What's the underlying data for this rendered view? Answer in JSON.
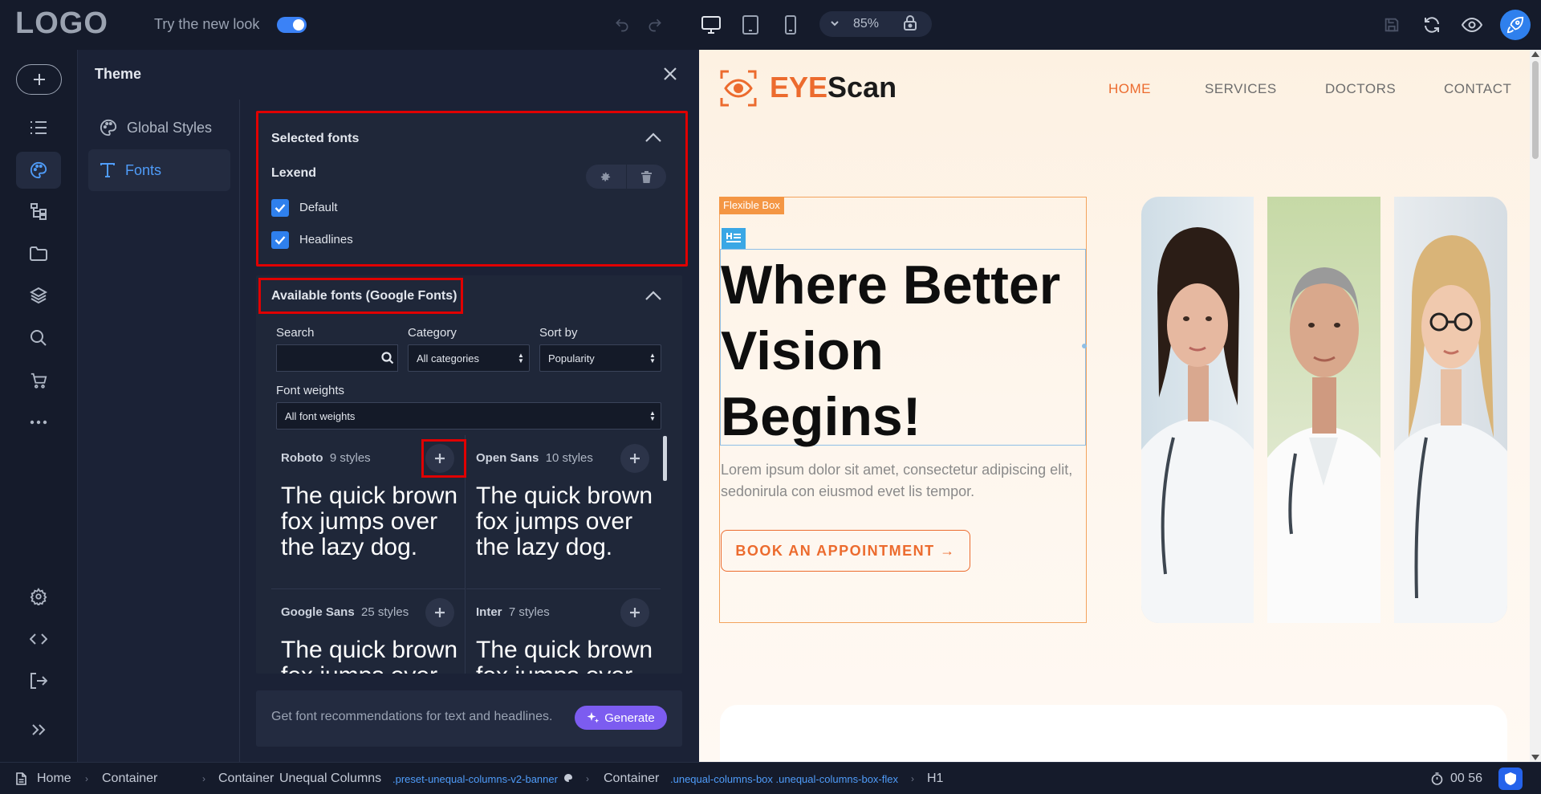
{
  "topbar": {
    "logo": "LOGO",
    "try_new_look": "Try the new look",
    "toggle_on": true,
    "zoom": "85%"
  },
  "theme_panel": {
    "title": "Theme",
    "nav": [
      {
        "label": "Global Styles",
        "icon": "palette-icon"
      },
      {
        "label": "Fonts",
        "icon": "text-icon",
        "active": true
      }
    ],
    "selected_fonts": {
      "title": "Selected fonts",
      "font_name": "Lexend",
      "options": [
        {
          "label": "Default",
          "checked": true
        },
        {
          "label": "Headlines",
          "checked": true
        }
      ]
    },
    "available_fonts": {
      "title": "Available fonts (Google Fonts)",
      "search_label": "Search",
      "search_value": "",
      "category_label": "Category",
      "category_value": "All categories",
      "sort_label": "Sort by",
      "sort_value": "Popularity",
      "weights_label": "Font weights",
      "weights_value": "All font weights",
      "fonts": [
        {
          "name": "Roboto",
          "styles": "9 styles",
          "sample": "The quick brown fox jumps over the lazy dog."
        },
        {
          "name": "Open Sans",
          "styles": "10 styles",
          "sample": "The quick brown fox jumps over the lazy dog."
        },
        {
          "name": "Google Sans",
          "styles": "25 styles",
          "sample": "The quick brown fox jumps over the lazy dog."
        },
        {
          "name": "Inter",
          "styles": "7 styles",
          "sample": "The quick brown fox jumps over the lazy dog."
        }
      ]
    },
    "generate": {
      "text": "Get font recommendations for text and headlines.",
      "button": "Generate"
    }
  },
  "canvas": {
    "brand_eye": "EYE",
    "brand_scan": "Scan",
    "nav": [
      "HOME",
      "SERVICES",
      "DOCTORS",
      "CONTACT"
    ],
    "flexbox_tag": "Flexible Box",
    "heading": "Where Better Vision Begins!",
    "lorem": "Lorem ipsum dolor sit amet, consectetur adipiscing elit, sedonirula con eiusmod evet lis tempor.",
    "cta": "BOOK AN APPOINTMENT →"
  },
  "statusbar": {
    "crumbs": {
      "home": "Home",
      "c1": "Container",
      "c2": "Container",
      "unequal": "Unequal Columns",
      "unequal_cls": ".preset-unequal-columns-v2-banner",
      "c3": "Container",
      "c3_cls": ".unequal-columns-box .unequal-columns-box-flex",
      "h1": "H1"
    },
    "timer": "00 56"
  },
  "colors": {
    "accent": "#2f80ed",
    "highlight": "#e00000",
    "brand_orange": "#ec6b2e",
    "generate": "#7c5cf0"
  }
}
